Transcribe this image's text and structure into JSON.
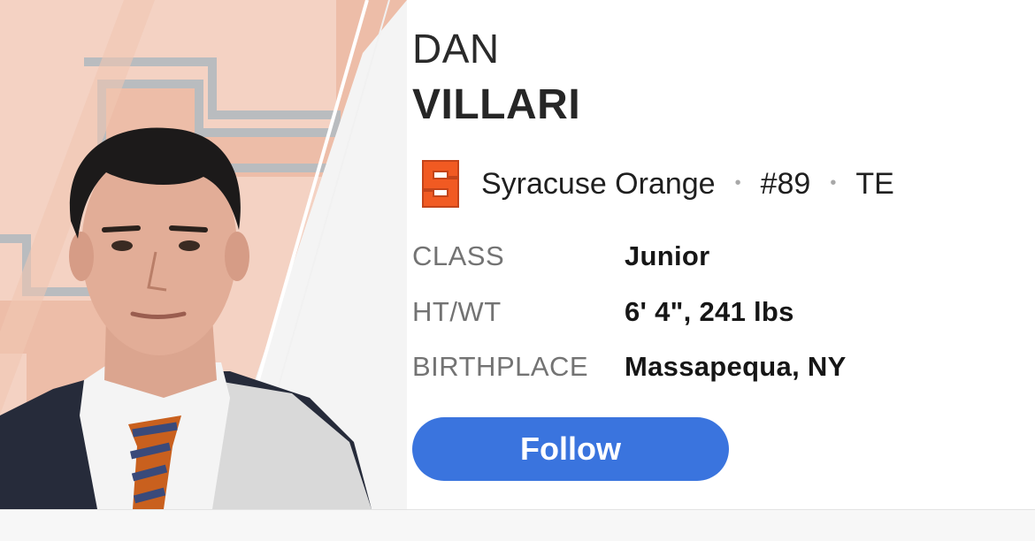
{
  "player": {
    "first_name": "DAN",
    "last_name": "VILLARI",
    "team": "Syracuse Orange",
    "team_logo_letter": "S",
    "number": "#89",
    "position": "TE",
    "separator": "•"
  },
  "stats": [
    {
      "label": "CLASS",
      "value": "Junior"
    },
    {
      "label": "HT/WT",
      "value": "6' 4\", 241 lbs"
    },
    {
      "label": "BIRTHPLACE",
      "value": "Massapequa, NY"
    }
  ],
  "actions": {
    "follow_label": "Follow"
  },
  "colors": {
    "team_orange": "#f15a22",
    "follow_blue": "#3a74de",
    "hero_bg": "#ebb9a3"
  },
  "icons": {
    "team_logo": "syracuse-s-logo-icon"
  }
}
